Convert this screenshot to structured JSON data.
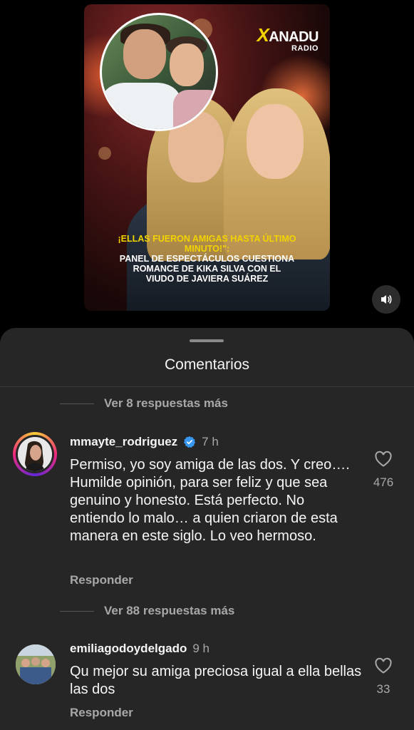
{
  "post": {
    "logo_name": "ANADU",
    "logo_x": "X",
    "logo_sub": "RADIO",
    "headline_highlight": "¡ELLAS FUERON AMIGAS HASTA ÚLTIMO MINUTO!\":",
    "headline_rest": "PANEL DE ESPECTÁCULOS CUESTIONA ROMANCE DE KIKA SILVA CON EL VIUDO DE JAVIERA SUÁREZ",
    "mute_icon": "speaker-icon"
  },
  "sheet": {
    "title": "Comentarios"
  },
  "threads": [
    {
      "more_replies": "Ver 8 respuestas más"
    },
    {
      "more_replies": "Ver 88 respuestas más"
    }
  ],
  "comments": [
    {
      "username": "mmayte_rodriguez",
      "verified": true,
      "time": "7 h",
      "text": "Permiso, yo soy amiga de las dos. Y creo…. Humilde opinión, para ser feliz y que sea genuino y honesto. Está perfecto. No entiendo lo malo… a quien criaron de esta manera en este siglo. Lo veo hermoso.",
      "reply_label": "Responder",
      "likes": "476"
    },
    {
      "username": "emiliagodoydelgado",
      "verified": false,
      "time": "9 h",
      "text": "Qu mejor su amiga preciosa igual a ella bellas las dos",
      "reply_label": "Responder",
      "likes": "33"
    }
  ],
  "colors": {
    "sheet_bg": "#262626",
    "accent_yellow": "#f2d300",
    "verified_blue": "#3897f0",
    "muted_text": "#a8a8a8"
  }
}
